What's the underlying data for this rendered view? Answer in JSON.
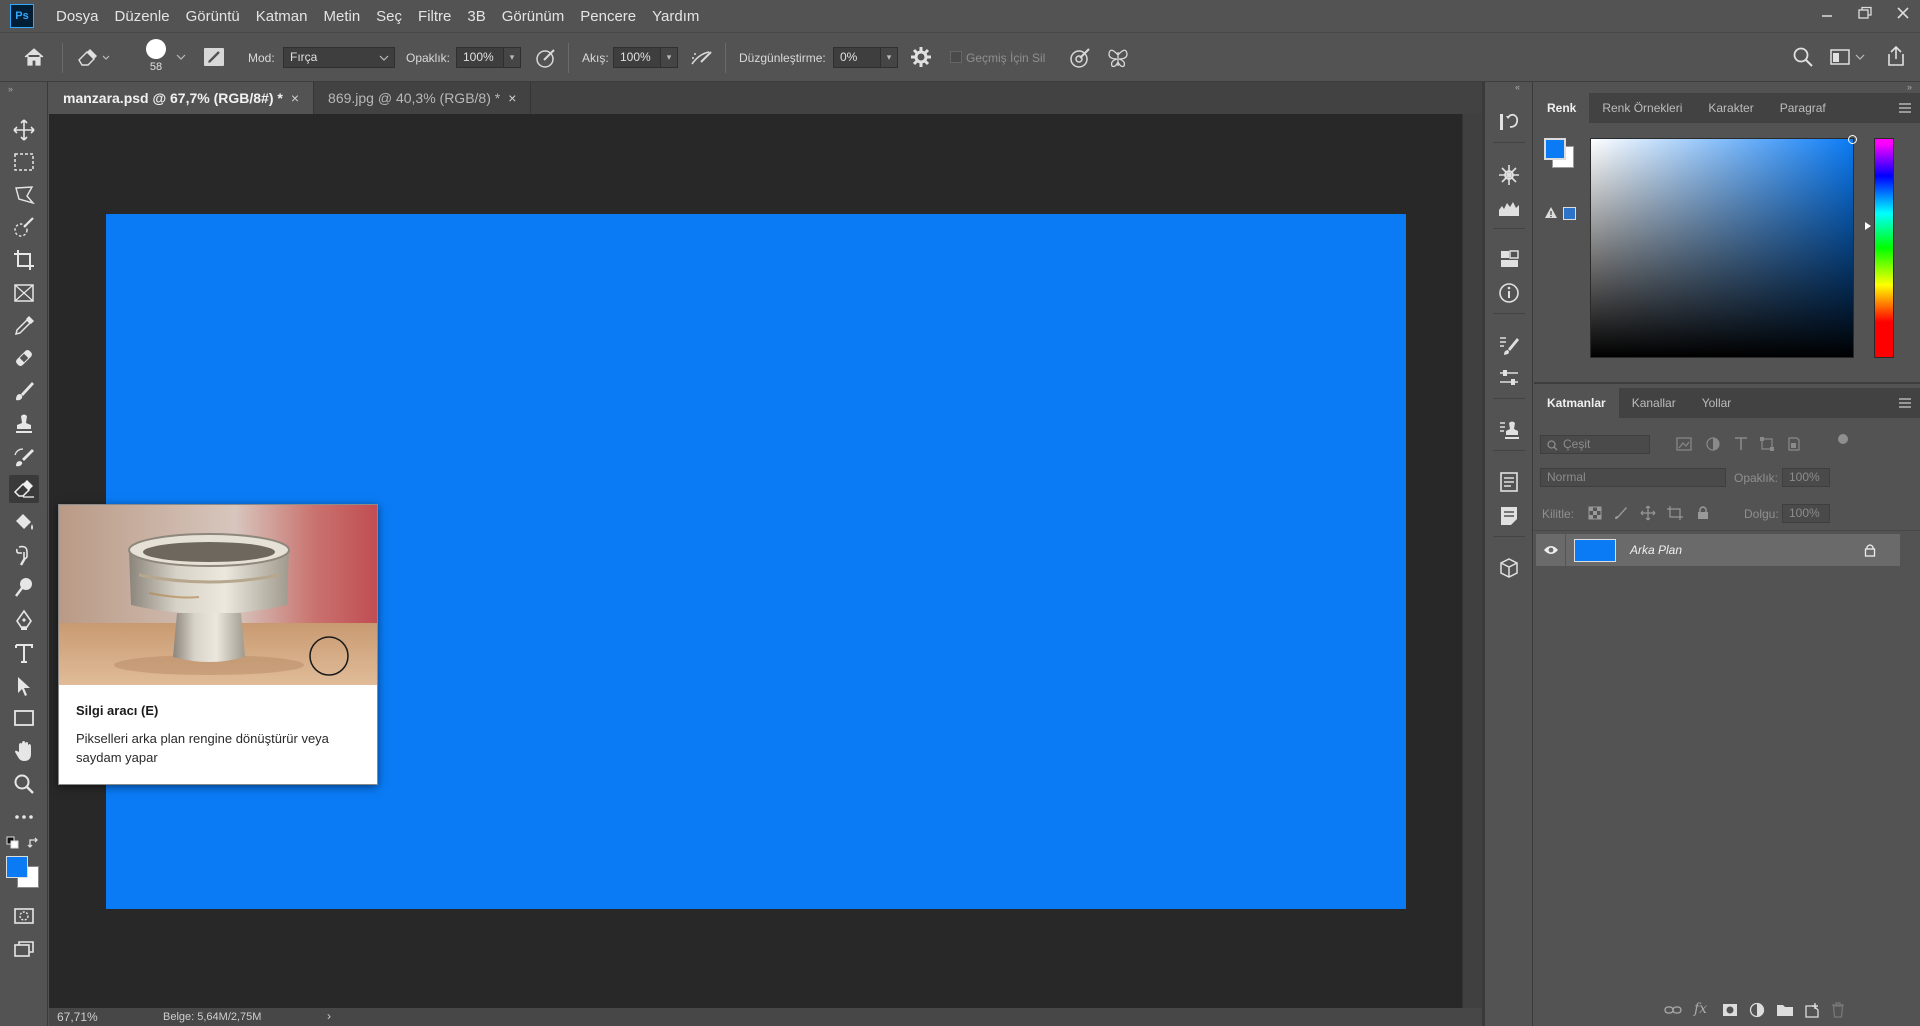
{
  "app": {
    "logo_text": "Ps"
  },
  "menu": {
    "items": [
      "Dosya",
      "Düzenle",
      "Görüntü",
      "Katman",
      "Metin",
      "Seç",
      "Filtre",
      "3B",
      "Görünüm",
      "Pencere",
      "Yardım"
    ]
  },
  "options_bar": {
    "brush_size": "58",
    "mode_label": "Mod:",
    "mode_value": "Fırça",
    "opacity_label": "Opaklık:",
    "opacity_value": "100%",
    "flow_label": "Akış:",
    "flow_value": "100%",
    "smoothing_label": "Düzgünleştirme:",
    "smoothing_value": "0%",
    "erase_history_label": "Geçmiş İçin Sil"
  },
  "tabs": [
    {
      "label": "manzara.psd @ 67,7% (RGB/8#) *",
      "close": "×",
      "active": true
    },
    {
      "label": "869.jpg @ 40,3% (RGB/8) *",
      "close": "×",
      "active": false
    }
  ],
  "canvas": {
    "fill_color": "#0a7bf5"
  },
  "status": {
    "zoom": "67,71%",
    "doc_info": "Belge: 5,64M/2,75M",
    "arrow": "›"
  },
  "tooltip": {
    "title": "Silgi aracı (E)",
    "description": "Pikselleri arka plan rengine dönüştürür veya saydam yapar"
  },
  "color_panel": {
    "tabs": [
      "Renk",
      "Renk Örnekleri",
      "Karakter",
      "Paragraf"
    ],
    "foreground": "#0a7bf5",
    "background": "#ffffff"
  },
  "layers_panel": {
    "tabs": [
      "Katmanlar",
      "Kanallar",
      "Yollar"
    ],
    "filter_placeholder": "Çeşit",
    "blend_mode": "Normal",
    "opacity_label": "Opaklık:",
    "opacity_value": "100%",
    "lock_label": "Kilitle:",
    "fill_label": "Dolgu:",
    "fill_value": "100%",
    "layers": [
      {
        "name": "Arka Plan",
        "thumb_color": "#0a7bf5"
      }
    ]
  },
  "colors": {
    "ui_bg": "#535353",
    "canvas_bg": "#282828",
    "accent": "#31a8ff"
  }
}
